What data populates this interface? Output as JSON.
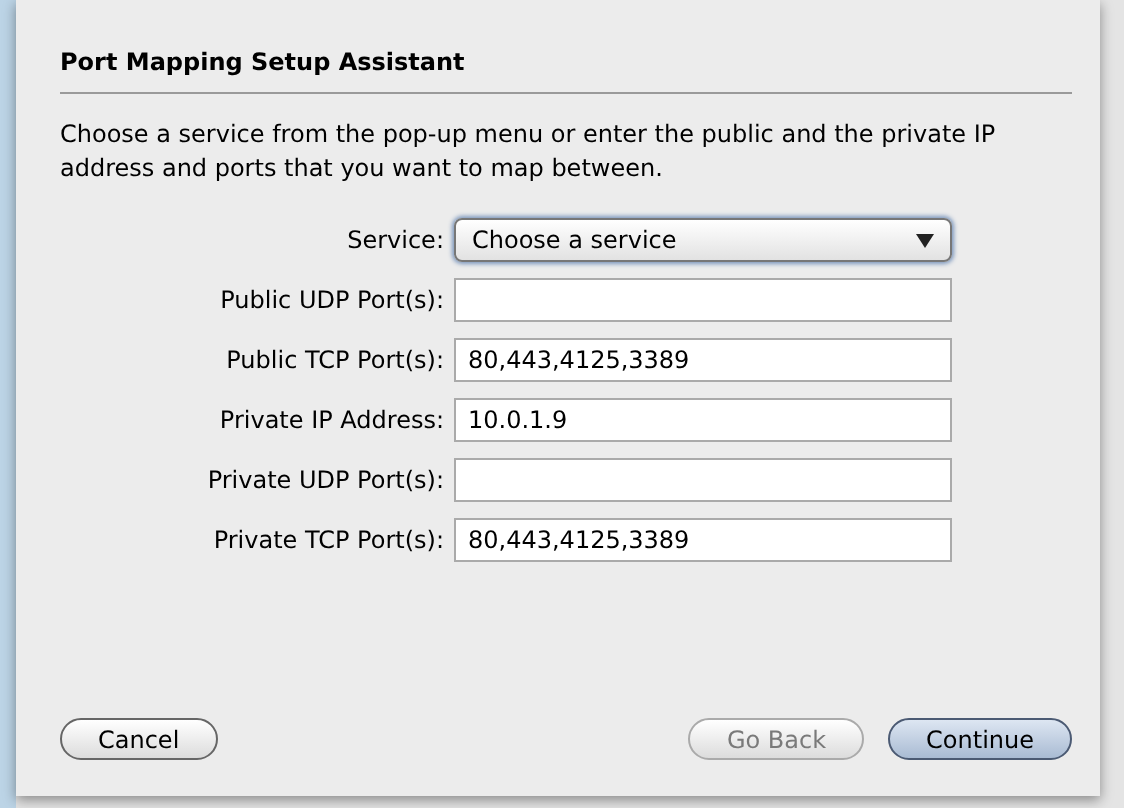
{
  "dialog": {
    "title": "Port Mapping Setup Assistant",
    "instructions": "Choose a service from the pop-up menu or enter the public and the private IP address and ports that you want to map between.",
    "fields": [
      {
        "kind": "popup",
        "label": "Service:",
        "value": "Choose a service"
      },
      {
        "kind": "text",
        "label": "Public UDP Port(s):"
      },
      {
        "kind": "text",
        "label": "Public TCP Port(s):",
        "value": "80,443,4125,3389"
      },
      {
        "kind": "text",
        "label": "Private IP Address:",
        "value": "10.0.1.9"
      },
      {
        "kind": "text",
        "label": "Private UDP Port(s):"
      },
      {
        "kind": "text",
        "label": "Private TCP Port(s):",
        "value": "80,443,4125,3389"
      }
    ],
    "left_buttons": [
      {
        "label": "Cancel",
        "disabled": false,
        "default": false
      }
    ],
    "right_buttons": [
      {
        "label": "Go Back",
        "disabled": true,
        "default": false
      },
      {
        "label": "Continue",
        "disabled": false,
        "default": true
      }
    ]
  }
}
